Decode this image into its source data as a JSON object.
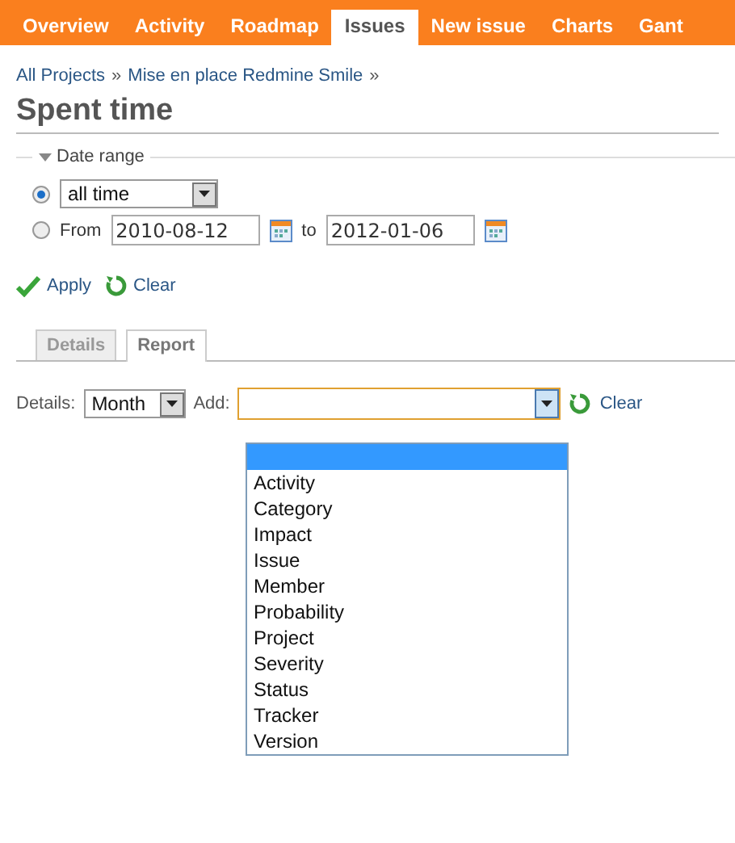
{
  "menu": [
    {
      "label": "Overview",
      "selected": false
    },
    {
      "label": "Activity",
      "selected": false
    },
    {
      "label": "Roadmap",
      "selected": false
    },
    {
      "label": "Issues",
      "selected": true
    },
    {
      "label": "New issue",
      "selected": false
    },
    {
      "label": "Charts",
      "selected": false
    },
    {
      "label": "Gant",
      "selected": false
    }
  ],
  "breadcrumb": [
    {
      "label": "All Projects",
      "separator": "»"
    },
    {
      "label": "Mise en place Redmine Smile",
      "separator": "»"
    }
  ],
  "title": "Spent time",
  "date_range": {
    "legend": "Date range",
    "expanded": true,
    "period": {
      "selected": true,
      "value": "all time"
    },
    "custom": {
      "selected": false,
      "from_label": "From",
      "from": "2010-08-12",
      "to_label": "to",
      "to": "2012-01-06"
    }
  },
  "actions": [
    {
      "kind": "apply",
      "label": "Apply"
    },
    {
      "kind": "clear",
      "label": "Clear"
    }
  ],
  "tabs": [
    {
      "label": "Details",
      "selected": false
    },
    {
      "label": "Report",
      "selected": true
    }
  ],
  "report": {
    "details_label": "Details:",
    "details_value": "Month",
    "add_label": "Add:",
    "clear_label": "Clear",
    "add_dropdown": {
      "open": true,
      "blank_option_highlighted": true,
      "options": [
        "Activity",
        "Category",
        "Impact",
        "Issue",
        "Member",
        "Probability",
        "Project",
        "Severity",
        "Status",
        "Tracker",
        "Version"
      ]
    }
  }
}
